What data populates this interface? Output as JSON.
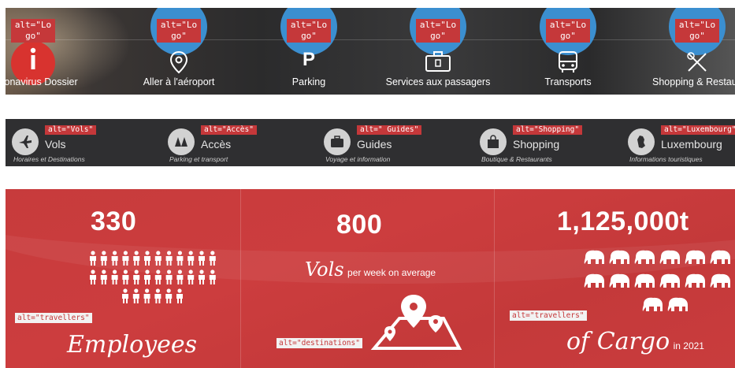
{
  "services": [
    {
      "alt": "alt=\"Logo\"",
      "label": "Coronavirus Dossier",
      "icon": "info-icon"
    },
    {
      "alt": "alt=\"Logo\"",
      "label": "Aller à l'aéroport",
      "icon": "location-pin-icon"
    },
    {
      "alt": "alt=\"Logo\"",
      "label": "Parking",
      "icon": "parking-icon"
    },
    {
      "alt": "alt=\"Logo\"",
      "label": "Services aux passagers",
      "icon": "suitcase-icon"
    },
    {
      "alt": "alt=\"Logo\"",
      "label": "Transports",
      "icon": "bus-icon"
    },
    {
      "alt": "alt=\"Logo\"",
      "label": "Shopping & Restaura",
      "icon": "cutlery-icon"
    }
  ],
  "nav": [
    {
      "alt": "alt=\"Vols\"",
      "title": "Vols",
      "sub": "Horaires et Destinations",
      "icon": "plane-icon"
    },
    {
      "alt": "alt=\"Accès\"",
      "title": "Accès",
      "sub": "Parking et transport",
      "icon": "map-icon"
    },
    {
      "alt": "alt=\" Guides\"",
      "title": "Guides",
      "sub": "Voyage et information",
      "icon": "briefcase-icon"
    },
    {
      "alt": "alt=\"Shopping\"",
      "title": "Shopping",
      "sub": "Boutique & Restaurants",
      "icon": "shopping-bag-icon"
    },
    {
      "alt": "alt=\"Luxembourg\"",
      "title": "Luxembourg",
      "sub": "Informations touristiques",
      "icon": "luxembourg-map-icon"
    }
  ],
  "stats": {
    "employees": {
      "value": "330",
      "caption": "Employees",
      "alt": "alt=\"travellers\"",
      "figure_rows": [
        "🯅🯅🯅🯅🯅🯅🯅🯅🯅🯅🯅🯅",
        "🯅🯅🯅🯅🯅🯅🯅🯅🯅🯅🯅🯅",
        "🯅🯅🯅🯅🯅🯅"
      ]
    },
    "flights": {
      "value": "800",
      "script": "Vols",
      "suffix": "per week on average",
      "alt": "alt=\"destinations\""
    },
    "cargo": {
      "value": "1,125,000t",
      "script": "of Cargo",
      "suffix": "in 2021",
      "alt": "alt=\"travellers\""
    }
  },
  "colors": {
    "accent_red": "#c73b3c",
    "service_blue": "#3b8fd0",
    "alt_tag_red": "#c5383a",
    "nav_bg": "#2f2f31"
  }
}
